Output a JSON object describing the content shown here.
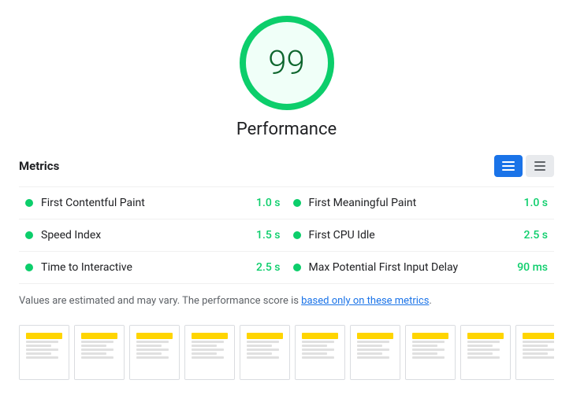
{
  "score": {
    "value": "99",
    "label": "Performance"
  },
  "metrics_section": {
    "title": "Metrics",
    "toggle": {
      "list_label": "List view",
      "grid_label": "Grid view"
    },
    "items": [
      {
        "name": "First Contentful Paint",
        "value": "1.0 s",
        "color": "#0cce6b"
      },
      {
        "name": "First Meaningful Paint",
        "value": "1.0 s",
        "color": "#0cce6b"
      },
      {
        "name": "Speed Index",
        "value": "1.5 s",
        "color": "#0cce6b"
      },
      {
        "name": "First CPU Idle",
        "value": "2.5 s",
        "color": "#0cce6b"
      },
      {
        "name": "Time to Interactive",
        "value": "2.5 s",
        "color": "#0cce6b"
      },
      {
        "name": "Max Potential First Input Delay",
        "value": "90 ms",
        "color": "#0cce6b"
      }
    ]
  },
  "disclaimer": {
    "text_before": "Values are estimated and may vary. The performance score is ",
    "link_text": "based only on these metrics",
    "text_after": "."
  },
  "filmstrip": {
    "thumbnails_count": 10
  }
}
